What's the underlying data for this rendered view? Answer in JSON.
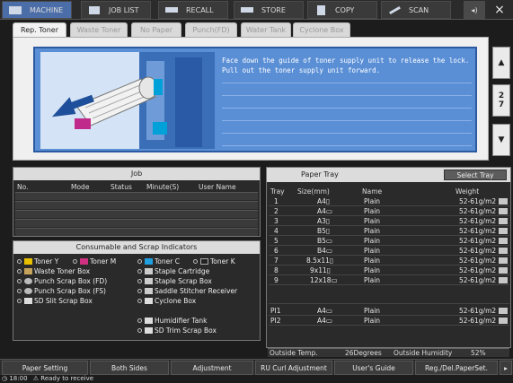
{
  "nav": {
    "items": [
      {
        "label": "MACHINE",
        "icon": "machine-icon",
        "active": true
      },
      {
        "label": "JOB LIST",
        "icon": "job-list-icon",
        "active": false
      },
      {
        "label": "RECALL",
        "icon": "recall-icon",
        "active": false
      },
      {
        "label": "STORE",
        "icon": "store-icon",
        "active": false
      },
      {
        "label": "COPY",
        "icon": "copy-icon",
        "active": false
      },
      {
        "label": "SCAN",
        "icon": "scan-icon",
        "active": false
      }
    ],
    "close_label": "×"
  },
  "tabs": [
    "Rep. Toner",
    "Waste Toner",
    "No Paper",
    "Punch(FD)",
    "Water Tank",
    "Cyclone Box"
  ],
  "guide": {
    "line1": "Face down the guide of toner supply unit to release the lock.",
    "line2": "Pull out the toner supply unit forward.",
    "page_current": "2",
    "page_total": "7"
  },
  "job": {
    "title": "Job",
    "columns": [
      "No.",
      "Mode",
      "Status",
      "Minute(S)",
      "User Name"
    ]
  },
  "consumables": {
    "title": "Consumable and Scrap Indicators",
    "left": [
      "Toner Y",
      "Toner M",
      "Waste Toner Box",
      "Punch Scrap Box (FD)",
      "Punch Scrap Box (FS)",
      "SD Slit Scrap Box"
    ],
    "right": [
      "Toner C",
      "Toner K",
      "Staple Cartridge",
      "Staple Scrap Box",
      "Saddle Stitcher Receiver",
      "Cyclone Box",
      "Humidifier Tank",
      "SD Trim Scrap Box"
    ]
  },
  "tray": {
    "title": "Paper Tray",
    "select_label": "Select Tray",
    "columns": [
      "Tray",
      "Size(mm)",
      "Name",
      "Weight"
    ],
    "rows": [
      {
        "tray": "1",
        "size": "A4▯",
        "name": "Plain",
        "weight": "52-61g/m2"
      },
      {
        "tray": "2",
        "size": "A4▭",
        "name": "Plain",
        "weight": "52-61g/m2"
      },
      {
        "tray": "3",
        "size": "A3▯",
        "name": "Plain",
        "weight": "52-61g/m2"
      },
      {
        "tray": "4",
        "size": "B5▯",
        "name": "Plain",
        "weight": "52-61g/m2"
      },
      {
        "tray": "5",
        "size": "B5▭",
        "name": "Plain",
        "weight": "52-61g/m2"
      },
      {
        "tray": "6",
        "size": "B4▭",
        "name": "Plain",
        "weight": "52-61g/m2"
      },
      {
        "tray": "7",
        "size": "8.5x11▯",
        "name": "Plain",
        "weight": "52-61g/m2"
      },
      {
        "tray": "8",
        "size": "9x11▯",
        "name": "Plain",
        "weight": "52-61g/m2"
      },
      {
        "tray": "9",
        "size": "12x18▭",
        "name": "Plain",
        "weight": "52-61g/m2"
      }
    ],
    "pi_rows": [
      {
        "tray": "PI1",
        "size": "A4▭",
        "name": "Plain",
        "weight": "52-61g/m2"
      },
      {
        "tray": "PI2",
        "size": "A4▭",
        "name": "Plain",
        "weight": "52-61g/m2"
      }
    ],
    "outside_temp_label": "Outside Temp.",
    "outside_temp": "26Degrees",
    "outside_humidity_label": "Outside Humidity",
    "outside_humidity": "52%"
  },
  "bottom": {
    "buttons": [
      "Paper Setting",
      "Both Sides",
      "Adjustment",
      "RU Curl Adjustment",
      "User's Guide",
      "Reg./Del.PaperSet.",
      "▸"
    ]
  },
  "status": {
    "time": "18:00",
    "message": "Ready to receive"
  },
  "colors": {
    "accent": "#4c6ea8",
    "guide_blue": "#5a8fd6",
    "toner_y": "#e8c000",
    "toner_m": "#d03080",
    "toner_c": "#20a0e0",
    "toner_k": "#222222"
  }
}
